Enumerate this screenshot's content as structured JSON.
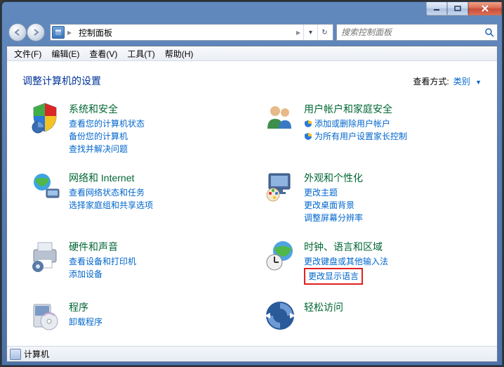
{
  "window": {
    "min_tooltip": "最小化",
    "max_tooltip": "最大化",
    "close_tooltip": "关闭"
  },
  "address": {
    "path": "控制面板",
    "refresh_glyph": "↻"
  },
  "search": {
    "placeholder": "搜索控制面板"
  },
  "menu": {
    "file": "文件",
    "file_key": "(F)",
    "edit": "编辑",
    "edit_key": "(E)",
    "view": "查看",
    "view_key": "(V)",
    "tools": "工具",
    "tools_key": "(T)",
    "help": "帮助",
    "help_key": "(H)"
  },
  "header": {
    "title": "调整计算机的设置",
    "view_label": "查看方式:",
    "view_value": "类别"
  },
  "cats": {
    "system": {
      "title": "系统和安全",
      "l1": "查看您的计算机状态",
      "l2": "备份您的计算机",
      "l3": "查找并解决问题"
    },
    "accounts": {
      "title": "用户帐户和家庭安全",
      "l1": "添加或删除用户帐户",
      "l2": "为所有用户设置家长控制"
    },
    "network": {
      "title": "网络和 Internet",
      "l1": "查看网络状态和任务",
      "l2": "选择家庭组和共享选项"
    },
    "appearance": {
      "title": "外观和个性化",
      "l1": "更改主题",
      "l2": "更改桌面背景",
      "l3": "调整屏幕分辨率"
    },
    "hardware": {
      "title": "硬件和声音",
      "l1": "查看设备和打印机",
      "l2": "添加设备"
    },
    "clock": {
      "title": "时钟、语言和区域",
      "l1": "更改键盘或其他输入法",
      "l2": "更改显示语言"
    },
    "programs": {
      "title": "程序",
      "l1": "卸载程序"
    },
    "ease": {
      "title": "轻松访问"
    }
  },
  "status": {
    "text": "计算机"
  }
}
